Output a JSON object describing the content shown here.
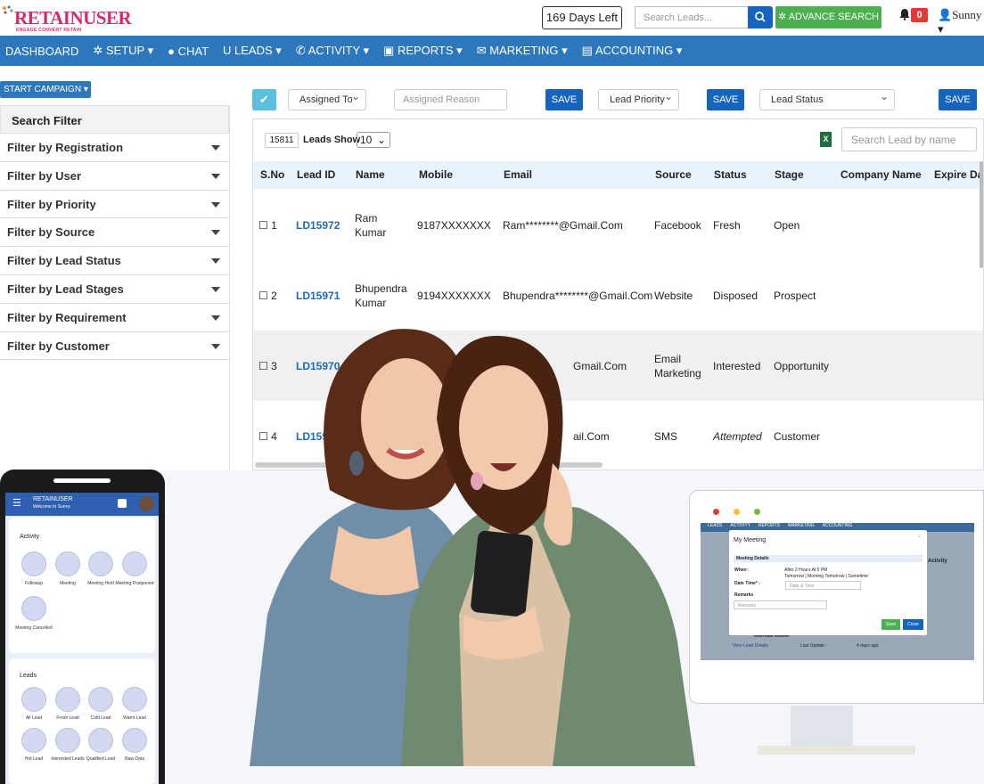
{
  "brand": {
    "name": "RETAINUSER",
    "tagline": "ENGAGE CONVERT RETAIN",
    "color": "#d9286e"
  },
  "topbar": {
    "days_left": "169 Days Left",
    "search_placeholder": "Search Leads...",
    "advance_search": "ADVANCE SEARCH",
    "notification_count": "0",
    "user": "Sunny"
  },
  "nav": {
    "items": [
      "DASHBOARD",
      "SETUP",
      "CHAT",
      "LEADS",
      "ACTIVITY",
      "REPORTS",
      "MARKETING",
      "ACCOUNTING"
    ]
  },
  "start_campaign": "START CAMPAIGN",
  "sidebar": {
    "title": "Search Filter",
    "filters": [
      "Filter by Registration",
      "Filter by User",
      "Filter by Priority",
      "Filter by Source",
      "Filter by Lead Status",
      "Filter by Lead Stages",
      "Filter by Requirement",
      "Filter by Customer"
    ]
  },
  "toolbar": {
    "assigned_to": "Assigned To",
    "assigned_reason_placeholder": "Assigned Reason",
    "save": "SAVE",
    "lead_priority": "Lead Priority",
    "lead_status": "Lead Status"
  },
  "table": {
    "total": "15811",
    "leads_show_label": "Leads Show",
    "page_size": "10",
    "search_placeholder": "Search Lead by name",
    "columns": [
      "S.No",
      "Lead ID",
      "Name",
      "Mobile",
      "Email",
      "Source",
      "Status",
      "Stage",
      "Company Name",
      "Expire Da"
    ],
    "rows": [
      {
        "sno": "1",
        "id": "LD15972",
        "name": "Ram Kumar",
        "mobile": "9187XXXXXXX",
        "email": "Ram********@Gmail.Com",
        "source": "Facebook",
        "status": "Fresh",
        "stage": "Open"
      },
      {
        "sno": "2",
        "id": "LD15971",
        "name": "Bhupendra Kumar",
        "mobile": "9194XXXXXXX",
        "email": "Bhupendra********@Gmail.Com",
        "source": "Website",
        "status": "Disposed",
        "stage": "Prospect"
      },
      {
        "sno": "3",
        "id": "LD15970",
        "name": "",
        "mobile": "XX",
        "email": "Gmail.Com",
        "source": "Email Marketing",
        "status": "Interested",
        "stage": "Opportunity"
      },
      {
        "sno": "4",
        "id": "LD15969",
        "name": "",
        "mobile": "XX",
        "email": "ail.Com",
        "source": "SMS",
        "status": "Attempted",
        "stage": "Customer"
      }
    ]
  },
  "phone": {
    "app": "RETAINUSER",
    "welcome": "Welcome to Sunny",
    "activity_title": "Activity",
    "activity": [
      "Followup",
      "Meeting",
      "Meeting Held",
      "Meeting Postponed",
      "Meeting Cancelled"
    ],
    "leads_title": "Leads",
    "leads": [
      "All Lead",
      "Fresh Lead",
      "Cold Lead",
      "Warm Lead",
      "Hot Lead",
      "Interested Leads",
      "Qualified Lead",
      "Raw Data"
    ]
  },
  "monitor": {
    "nav": [
      "LEADS",
      "ACTIVITY",
      "REPORTS",
      "MARKETING",
      "ACCOUNTING"
    ],
    "modal_title": "My Meeting",
    "meeting_details": "Meeting Details",
    "when_label": "When :",
    "when_options": "After 2 Hours  At 5 PM",
    "when_options2": "Tomorrow | Morning  Tomorrow | Sometime",
    "date_label": "Date Time* :",
    "date_placeholder": "Date & Time",
    "remarks_label": "Remarks",
    "remarks_placeholder": "Remarks",
    "save": "Save",
    "close": "Close",
    "behind_activity": "Activity",
    "alt_mobile": "Alternate Mobile:",
    "view_details": "View Lead Details",
    "last_update": "Last Update :",
    "ago": "4 days ago"
  }
}
